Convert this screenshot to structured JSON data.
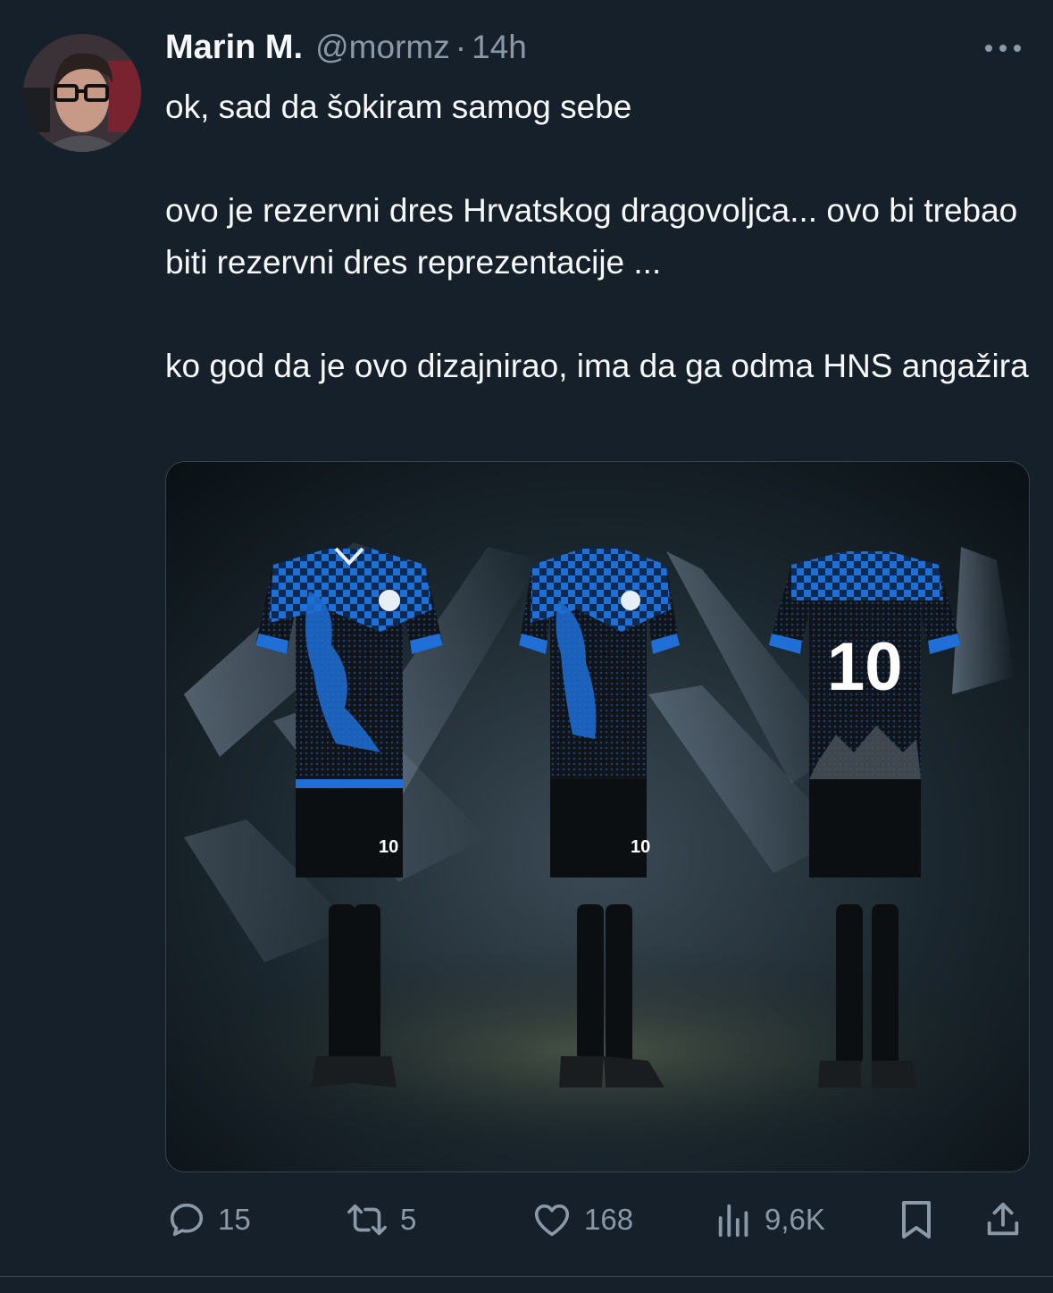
{
  "tweet": {
    "author_name": "Marin M.",
    "handle": "@mormz",
    "separator": "·",
    "time": "14h",
    "paragraphs": [
      "ok, sad da šokiram samog sebe",
      "ovo je rezervni dres Hrvatskog dragovoljca... ovo bi trebao biti rezervni dres reprezentacije ...",
      "ko god da je ovo dizajnirao, ima da ga odma HNS angažira"
    ],
    "media": {
      "kit_numbers": [
        "10",
        "10",
        "10"
      ]
    }
  },
  "actions": {
    "replies": "15",
    "reposts": "5",
    "likes": "168",
    "views": "9,6K"
  },
  "colors": {
    "background": "#15202b",
    "text": "#f7f9f9",
    "secondary": "#8b98a5",
    "kit_blue": "#1f6fd6"
  },
  "icons": [
    "more-icon",
    "reply-icon",
    "repost-icon",
    "like-icon",
    "views-icon",
    "bookmark-icon",
    "share-icon"
  ]
}
